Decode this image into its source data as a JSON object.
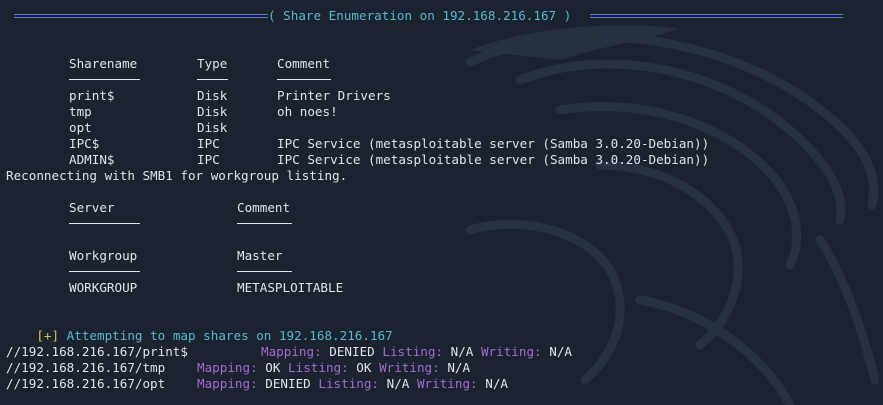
{
  "header": {
    "title": "( Share Enumeration on 192.168.216.167 )"
  },
  "shares": {
    "headers": {
      "name": "Sharename",
      "type": "Type",
      "comment": "Comment"
    },
    "rows": [
      {
        "name": "print$",
        "type": "Disk",
        "comment": "Printer Drivers"
      },
      {
        "name": "tmp",
        "type": "Disk",
        "comment": "oh noes!"
      },
      {
        "name": "opt",
        "type": "Disk",
        "comment": ""
      },
      {
        "name": "IPC$",
        "type": "IPC",
        "comment": "IPC Service (metasploitable server (Samba 3.0.20-Debian))"
      },
      {
        "name": "ADMIN$",
        "type": "IPC",
        "comment": "IPC Service (metasploitable server (Samba 3.0.20-Debian))"
      }
    ]
  },
  "reconnect_text": "Reconnecting with SMB1 for workgroup listing.",
  "servers": {
    "headers": {
      "server": "Server",
      "comment": "Comment"
    }
  },
  "workgroups": {
    "headers": {
      "workgroup": "Workgroup",
      "master": "Master"
    },
    "rows": [
      {
        "workgroup": "WORKGROUP",
        "master": "METASPLOITABLE"
      }
    ]
  },
  "attempt": {
    "prefix": "[+]",
    "text": " Attempting to map shares on 192.168.216.167"
  },
  "mappings": [
    {
      "path": "//192.168.216.167/print$",
      "mapping_label": "Mapping:",
      "mapping": "DENIED",
      "listing_label": "Listing:",
      "listing": "N/A",
      "writing_label": "Writing:",
      "writing": "N/A"
    },
    {
      "path": "//192.168.216.167/tmp",
      "mapping_label": "Mapping:",
      "mapping": "OK",
      "listing_label": "Listing:",
      "listing": "OK",
      "writing_label": "Writing:",
      "writing": "N/A"
    },
    {
      "path": "//192.168.216.167/opt",
      "mapping_label": "Mapping:",
      "mapping": "DENIED",
      "listing_label": "Listing:",
      "listing": "N/A",
      "writing_label": "Writing:",
      "writing": "N/A"
    }
  ],
  "colors": {
    "background": "#1b2230",
    "text": "#dfe3ea",
    "title": "#55b9c9",
    "label": "#a46ad0",
    "plus": "#d6c24c",
    "separator": "#5f7ad8"
  }
}
